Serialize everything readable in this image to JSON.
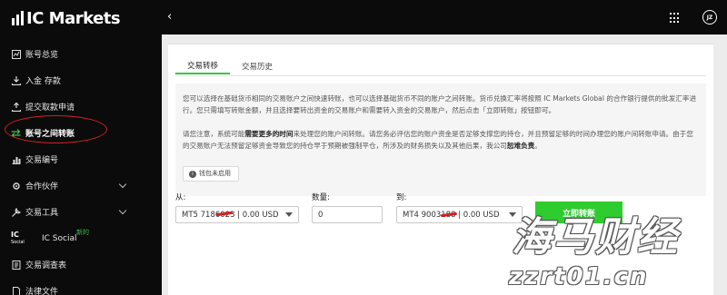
{
  "brand": {
    "logo_text": "IC Markets"
  },
  "sidebar": {
    "items": [
      {
        "label": "账号总览",
        "icon": "chart-icon"
      },
      {
        "label": "入金 存款",
        "icon": "download-icon"
      },
      {
        "label": "提交取款申请",
        "icon": "upload-icon"
      },
      {
        "label": "账号之间转账",
        "icon": "transfer-icon",
        "active": true
      },
      {
        "label": "交易编号",
        "icon": "bar-chart-icon"
      },
      {
        "label": "合作伙伴",
        "icon": "gear-icon",
        "expandable": true
      },
      {
        "label": "交易工具",
        "icon": "tools-icon",
        "expandable": true
      },
      {
        "label": "IC Social",
        "icon": "ic-social-icon",
        "badge": "新的",
        "sub_icon_title": "IC",
        "sub_icon_caption": "Social"
      },
      {
        "label": "交易调查表",
        "icon": "survey-icon"
      },
      {
        "label": "法律文件",
        "icon": "document-icon"
      }
    ]
  },
  "topbar": {
    "back_glyph": "‹",
    "avatar_initials": "JZ"
  },
  "tabs": [
    {
      "label": "交易转移",
      "active": true
    },
    {
      "label": "交易历史",
      "active": false
    }
  ],
  "info": {
    "para1": "您可以选择在基础货币相同的交易账户之间快速转账，也可以选择基础货币不同的账户之间转账。货币兑换汇率将按照 IC Markets Global 的合作银行提供的批发汇率进行。您只需填写转账金额，并且选择要转出资金的交易账户和需要转入资金的交易账户，然后点击「立即转账」按钮即可。",
    "para2_start": "请您注意，系统可能",
    "para2_bold1": "需要更多的时间",
    "para2_mid": "来处理您的账户间转账。请您务必评估您的账户资金是否足够支撑您的持仓，并且预留足够的时间办理您的账户间转账申请。由于您的交易账户无法预留足够资金导致您的持仓早于预期被强制平仓，所涉及的财务损失以及其他后果，我公司",
    "para2_bold2": "恕难负责",
    "para2_end": "。"
  },
  "wallet_notice": {
    "icon_glyph": "i",
    "text": "钱包未启用"
  },
  "form": {
    "from_label": "从:",
    "from_value": "MT5 7186023 | 0.00 USD",
    "amount_label": "数量:",
    "amount_value": "0",
    "to_label": "到:",
    "to_value": "MT4 9003188 | 0.00 USD",
    "submit_label": "立即转账"
  },
  "watermark": {
    "main": "海马财经",
    "sub": "zzrt01.cn"
  },
  "colors": {
    "accent": "#3fbf4f",
    "sidebar_bg": "#0b0b0b",
    "annotation_red": "#d3202a",
    "button_green": "#2ecc2e"
  }
}
